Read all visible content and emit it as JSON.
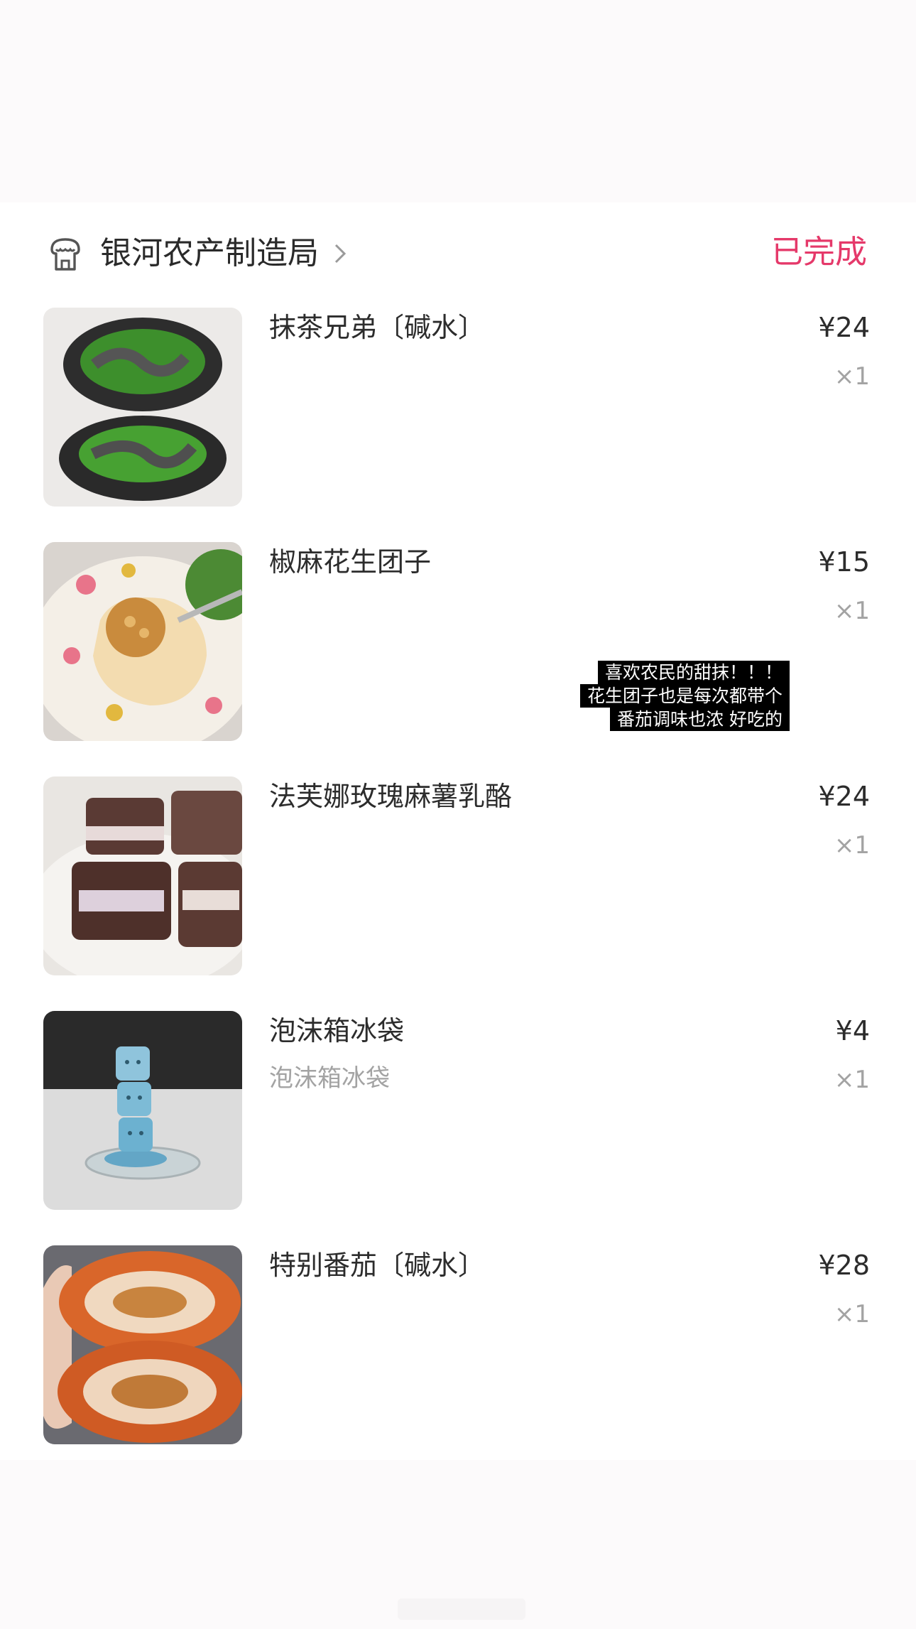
{
  "shop": {
    "name": "银河农产制造局",
    "status": "已完成",
    "icon": "shop-icon",
    "status_color": "#e5396a"
  },
  "items": [
    {
      "name": "抹茶兄弟〔碱水〕",
      "sub": "",
      "price": "¥24",
      "qty": "×1",
      "image": "matcha-bread-photo"
    },
    {
      "name": "椒麻花生团子",
      "sub": "",
      "price": "¥15",
      "qty": "×1",
      "image": "peanut-dumpling-photo"
    },
    {
      "name": "法芙娜玫瑰麻薯乳酪",
      "sub": "",
      "price": "¥24",
      "qty": "×1",
      "image": "chocolate-mochi-cheese-photo"
    },
    {
      "name": "泡沫箱冰袋",
      "sub": "泡沫箱冰袋",
      "price": "¥4",
      "qty": "×1",
      "image": "ice-cube-photo"
    },
    {
      "name": "特别番茄〔碱水〕",
      "sub": "",
      "price": "¥28",
      "qty": "×1",
      "image": "tomato-bread-photo"
    }
  ],
  "overlay_caption": {
    "lines": [
      "喜欢农民的甜抹！！！",
      "花生团子也是每次都带个",
      "番茄调味也浓 好吃的"
    ]
  }
}
